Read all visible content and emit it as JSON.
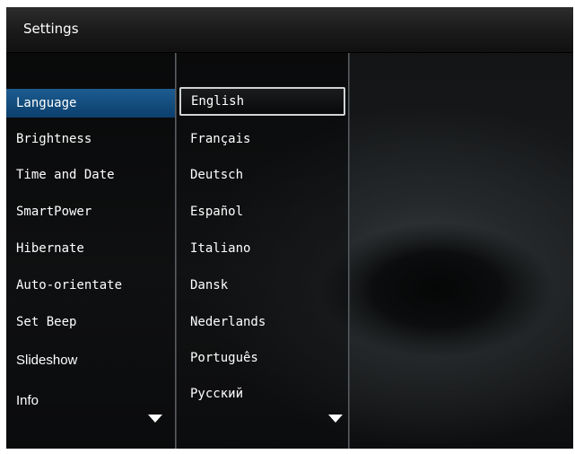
{
  "header": {
    "title": "Settings"
  },
  "settings_menu": {
    "items": [
      {
        "label": "Language",
        "selected": true
      },
      {
        "label": "Brightness"
      },
      {
        "label": "Time and Date"
      },
      {
        "label": "SmartPower"
      },
      {
        "label": "Hibernate"
      },
      {
        "label": "Auto-orientate"
      },
      {
        "label": "Set Beep"
      },
      {
        "label": "Slideshow"
      },
      {
        "label": "Info"
      }
    ],
    "more_icon": "chevron-down-icon"
  },
  "language_menu": {
    "items": [
      {
        "label": "English",
        "selected": true
      },
      {
        "label": "Français"
      },
      {
        "label": "Deutsch"
      },
      {
        "label": "Español"
      },
      {
        "label": "Italiano"
      },
      {
        "label": "Dansk"
      },
      {
        "label": "Nederlands"
      },
      {
        "label": "Português"
      },
      {
        "label": "Русский"
      }
    ],
    "more_icon": "chevron-down-icon"
  },
  "colors": {
    "selection_blue": "#1d5c90",
    "focus_border": "#cfd3d6",
    "text": "#ffffff"
  }
}
